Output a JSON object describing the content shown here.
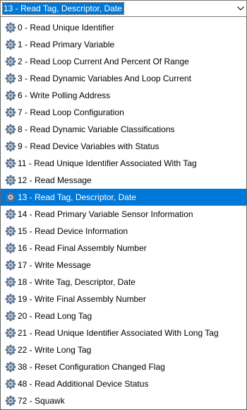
{
  "combo": {
    "selected_value": "13 - Read Tag, Descriptor, Date",
    "arrow_icon": "chevron-down-icon"
  },
  "list": {
    "item_icon": "gear-icon",
    "selected_index": 10,
    "items": [
      {
        "label": "0 - Read Unique Identifier"
      },
      {
        "label": "1 - Read Primary Variable"
      },
      {
        "label": "2 - Read Loop Current And Percent Of Range"
      },
      {
        "label": "3 - Read Dynamic Variables And Loop Current"
      },
      {
        "label": "6 - Write Polling Address"
      },
      {
        "label": "7 - Read Loop Configuration"
      },
      {
        "label": "8 - Read Dynamic Variable Classifications"
      },
      {
        "label": "9 - Read Device Variables with Status"
      },
      {
        "label": "11 - Read Unique Identifier Associated With Tag"
      },
      {
        "label": "12 - Read Message"
      },
      {
        "label": "13 - Read Tag, Descriptor, Date"
      },
      {
        "label": "14 - Read Primary Variable Sensor Information"
      },
      {
        "label": "15 - Read Device Information"
      },
      {
        "label": "16 - Read Final Assembly Number"
      },
      {
        "label": "17 - Write Message"
      },
      {
        "label": "18 - Write Tag, Descriptor, Date"
      },
      {
        "label": "19 - Write Final Assembly Number"
      },
      {
        "label": "20 - Read Long Tag"
      },
      {
        "label": "21 - Read Unique Identifier Associated With Long Tag"
      },
      {
        "label": "22 - Write Long Tag"
      },
      {
        "label": "38 - Reset Configuration Changed Flag"
      },
      {
        "label": "48 - Read Additional Device Status"
      },
      {
        "label": "72 - Squawk"
      }
    ]
  },
  "colors": {
    "selection": "#0078d7",
    "selection_text": "#ffffff",
    "gear_outer": "#5a6f8c",
    "gear_inner": "#c9d6e6"
  }
}
